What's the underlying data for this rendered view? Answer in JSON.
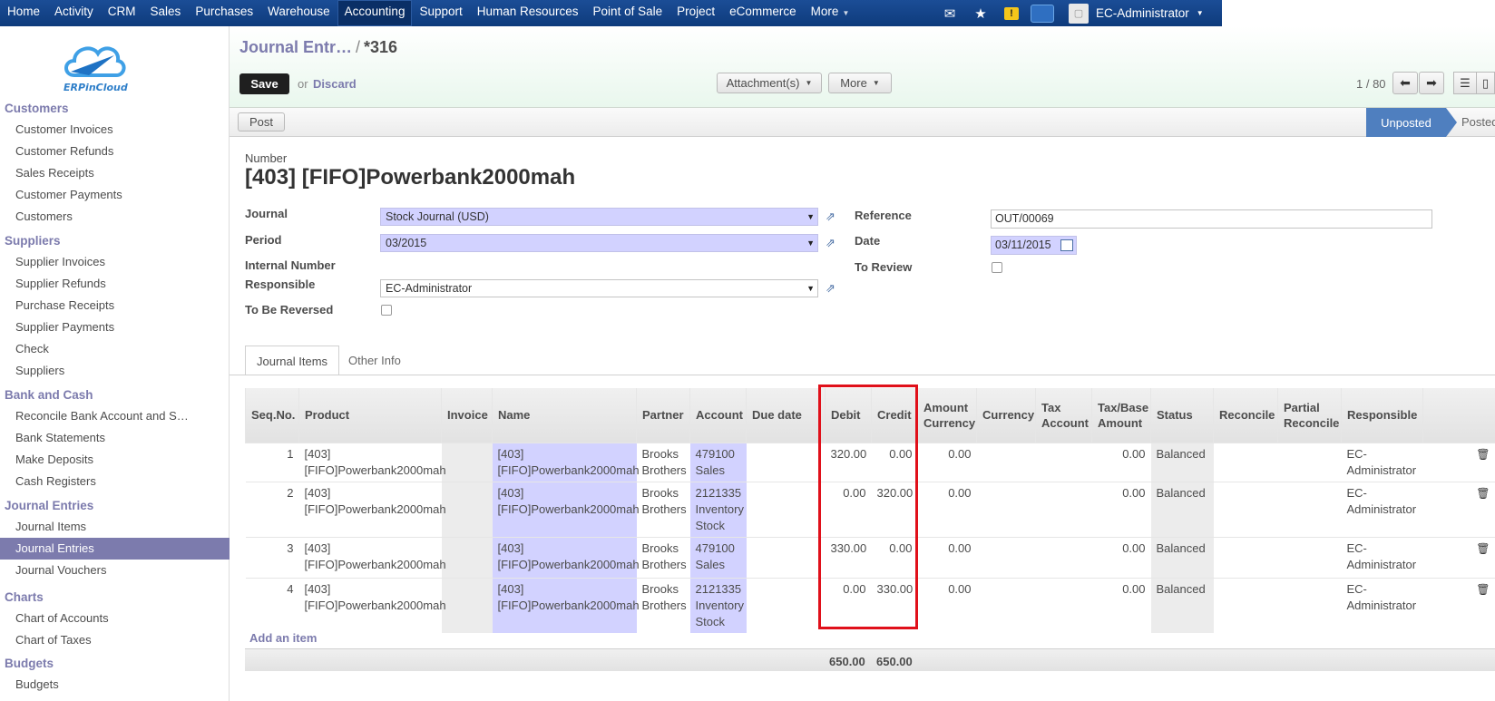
{
  "topnav": {
    "items": [
      "Home",
      "Activity",
      "CRM",
      "Sales",
      "Purchases",
      "Warehouse",
      "Accounting",
      "Support",
      "Human Resources",
      "Point of Sale",
      "Project",
      "eCommerce"
    ],
    "more_label": "More",
    "user_name": "EC-Administrator"
  },
  "sidebar": {
    "brand": "ERPinCloud",
    "groups": [
      {
        "heading": "Customers",
        "items": [
          "Customer Invoices",
          "Customer Refunds",
          "Sales Receipts",
          "Customer Payments",
          "Customers"
        ]
      },
      {
        "heading": "Suppliers",
        "items": [
          "Supplier Invoices",
          "Supplier Refunds",
          "Purchase Receipts",
          "Supplier Payments",
          "Check",
          "Suppliers"
        ]
      },
      {
        "heading": "Bank and Cash",
        "items": [
          "Reconcile Bank Account and S…",
          "Bank Statements",
          "Make Deposits",
          "Cash Registers"
        ]
      },
      {
        "heading": "Journal Entries",
        "items": [
          "Journal Items",
          "Journal Entries",
          "Journal Vouchers"
        ]
      },
      {
        "heading": "Charts",
        "items": [
          "Chart of Accounts",
          "Chart of Taxes"
        ]
      },
      {
        "heading": "Budgets",
        "items": [
          "Budgets"
        ]
      }
    ]
  },
  "header": {
    "breadcrumb_parent": "Journal Entr…",
    "breadcrumb_sep": "/",
    "breadcrumb_current": "*316",
    "save_label": "Save",
    "or_label": "or",
    "discard_label": "Discard",
    "attachments_label": "Attachment(s)",
    "more_label": "More",
    "pager": "1 / 80"
  },
  "statusbar": {
    "post_label": "Post",
    "stage_unposted": "Unposted",
    "stage_posted": "Posted"
  },
  "form": {
    "number_label": "Number",
    "number_value": "[403] [FIFO]Powerbank2000mah",
    "journal_label": "Journal",
    "journal_value": "Stock Journal (USD)",
    "period_label": "Period",
    "period_value": "03/2015",
    "internal_number_label": "Internal Number",
    "responsible_label": "Responsible",
    "responsible_value": "EC-Administrator",
    "to_be_reversed_label": "To Be Reversed",
    "reference_label": "Reference",
    "reference_value": "OUT/00069",
    "date_label": "Date",
    "date_value": "03/11/2015",
    "to_review_label": "To Review"
  },
  "tabs": [
    "Journal Items",
    "Other Info"
  ],
  "table": {
    "headers": [
      "Seq.No.",
      "Product",
      "Invoice",
      "Name",
      "Partner",
      "Account",
      "Due date",
      "Debit",
      "Credit",
      "Amount Currency",
      "Currency",
      "Tax Account",
      "Tax/Base Amount",
      "Status",
      "Reconcile",
      "Partial Reconcile",
      "Responsible"
    ],
    "rows": [
      {
        "seq": "1",
        "product": "[403] [FIFO]Powerbank2000mah",
        "name": "[403] [FIFO]Powerbank2000mah",
        "partner": "Brooks Brothers",
        "account": "479100 Sales",
        "debit": "320.00",
        "credit": "0.00",
        "amount_currency": "0.00",
        "tax_base": "0.00",
        "status": "Balanced",
        "responsible": "EC-Administrator"
      },
      {
        "seq": "2",
        "product": "[403] [FIFO]Powerbank2000mah",
        "name": "[403] [FIFO]Powerbank2000mah",
        "partner": "Brooks Brothers",
        "account": "2121335 Inventory Stock",
        "debit": "0.00",
        "credit": "320.00",
        "amount_currency": "0.00",
        "tax_base": "0.00",
        "status": "Balanced",
        "responsible": "EC-Administrator"
      },
      {
        "seq": "3",
        "product": "[403] [FIFO]Powerbank2000mah",
        "name": "[403] [FIFO]Powerbank2000mah",
        "partner": "Brooks Brothers",
        "account": "479100 Sales",
        "debit": "330.00",
        "credit": "0.00",
        "amount_currency": "0.00",
        "tax_base": "0.00",
        "status": "Balanced",
        "responsible": "EC-Administrator"
      },
      {
        "seq": "4",
        "product": "[403] [FIFO]Powerbank2000mah",
        "name": "[403] [FIFO]Powerbank2000mah",
        "partner": "Brooks Brothers",
        "account": "2121335 Inventory Stock",
        "debit": "0.00",
        "credit": "330.00",
        "amount_currency": "0.00",
        "tax_base": "0.00",
        "status": "Balanced",
        "responsible": "EC-Administrator"
      }
    ],
    "add_item_label": "Add an item",
    "total_debit": "650.00",
    "total_credit": "650.00"
  },
  "colors": {
    "accent": "#7c7bad",
    "nav": "#0e3b7c",
    "highlight": "#e0101a",
    "editable": "#d2d2ff"
  }
}
